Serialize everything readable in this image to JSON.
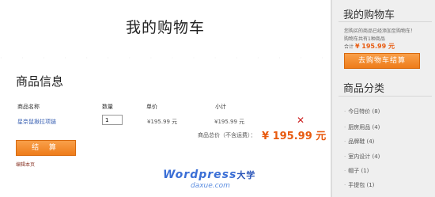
{
  "page": {
    "title": "我的购物车"
  },
  "cart": {
    "section_title": "商品信息",
    "headers": {
      "name": "商品名称",
      "qty": "数量",
      "price": "单价",
      "subtotal": "小计"
    },
    "item": {
      "name": "星奈鼠揪拉项链",
      "qty": "1",
      "price": "¥195.99 元",
      "subtotal": "¥195.99 元",
      "remove": "✕"
    },
    "total_label": "商品总价（不含运费）：",
    "total": "¥ 195.99 元",
    "checkout_label": "结 算",
    "edit_link": "编辑本页"
  },
  "watermark": {
    "main": "Wordpress",
    "cn": "大学",
    "sub": "daxue.com"
  },
  "sidebar": {
    "cart_title": "我的购物车",
    "cart_line1": "您购买的商品已经添加至购物车！",
    "cart_line2": "购物车共有1种商品",
    "cart_total_label": "合计",
    "cart_total": "¥ 195.99 元",
    "cart_button": "去购物车结算",
    "categories_title": "商品分类",
    "categories": [
      "今日特价 (8)",
      "厨房用品 (4)",
      "品牌鞋 (4)",
      "室内设计 (4)",
      "帽子 (1)",
      "手提包 (1)"
    ]
  }
}
